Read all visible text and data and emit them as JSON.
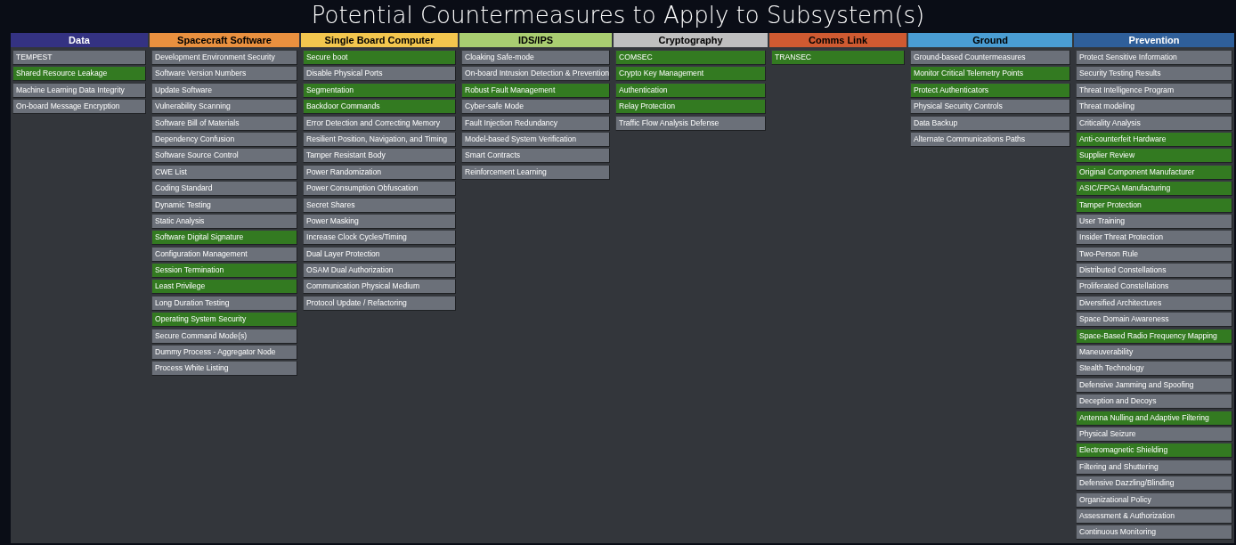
{
  "title": "Potential Countermeasures to Apply to Subsystem(s)",
  "columns": [
    {
      "name": "Data",
      "color": "#343282",
      "items": [
        {
          "label": "TEMPEST",
          "selected": false
        },
        {
          "label": "Shared Resource Leakage",
          "selected": true
        },
        {
          "label": "Machine Learning Data Integrity",
          "selected": false
        },
        {
          "label": "On-board Message Encryption",
          "selected": false
        }
      ]
    },
    {
      "name": "Spacecraft Software",
      "color": "#e9903f",
      "items": [
        {
          "label": "Development Environment Security",
          "selected": false
        },
        {
          "label": "Software Version Numbers",
          "selected": false
        },
        {
          "label": "Update Software",
          "selected": false
        },
        {
          "label": "Vulnerability Scanning",
          "selected": false
        },
        {
          "label": "Software Bill of Materials",
          "selected": false
        },
        {
          "label": "Dependency Confusion",
          "selected": false
        },
        {
          "label": "Software Source Control",
          "selected": false
        },
        {
          "label": "CWE List",
          "selected": false
        },
        {
          "label": "Coding Standard",
          "selected": false
        },
        {
          "label": "Dynamic Testing",
          "selected": false
        },
        {
          "label": "Static Analysis",
          "selected": false
        },
        {
          "label": "Software Digital Signature",
          "selected": true
        },
        {
          "label": "Configuration Management",
          "selected": false
        },
        {
          "label": "Session Termination",
          "selected": true
        },
        {
          "label": "Least Privilege",
          "selected": true
        },
        {
          "label": "Long Duration Testing",
          "selected": false
        },
        {
          "label": "Operating System Security",
          "selected": true
        },
        {
          "label": "Secure Command Mode(s)",
          "selected": false
        },
        {
          "label": "Dummy Process - Aggregator Node",
          "selected": false
        },
        {
          "label": "Process White Listing",
          "selected": false
        }
      ]
    },
    {
      "name": "Single Board Computer",
      "color": "#f3c64e",
      "items": [
        {
          "label": "Secure boot",
          "selected": true
        },
        {
          "label": "Disable Physical Ports",
          "selected": false
        },
        {
          "label": "Segmentation",
          "selected": true
        },
        {
          "label": "Backdoor Commands",
          "selected": true
        },
        {
          "label": "Error Detection and Correcting Memory",
          "selected": false
        },
        {
          "label": "Resilient Position, Navigation, and Timing",
          "selected": false
        },
        {
          "label": "Tamper Resistant Body",
          "selected": false
        },
        {
          "label": "Power Randomization",
          "selected": false
        },
        {
          "label": "Power Consumption Obfuscation",
          "selected": false
        },
        {
          "label": "Secret Shares",
          "selected": false
        },
        {
          "label": "Power Masking",
          "selected": false
        },
        {
          "label": "Increase Clock Cycles/Timing",
          "selected": false
        },
        {
          "label": "Dual Layer Protection",
          "selected": false
        },
        {
          "label": "OSAM Dual Authorization",
          "selected": false
        },
        {
          "label": "Communication Physical Medium",
          "selected": false
        },
        {
          "label": "Protocol Update / Refactoring",
          "selected": false
        }
      ]
    },
    {
      "name": "IDS/IPS",
      "color": "#a9cd71",
      "items": [
        {
          "label": "Cloaking Safe-mode",
          "selected": false
        },
        {
          "label": "On-board Intrusion Detection & Prevention",
          "selected": false
        },
        {
          "label": "Robust Fault Management",
          "selected": true
        },
        {
          "label": "Cyber-safe Mode",
          "selected": false
        },
        {
          "label": "Fault Injection Redundancy",
          "selected": false
        },
        {
          "label": "Model-based System Verification",
          "selected": false
        },
        {
          "label": "Smart Contracts",
          "selected": false
        },
        {
          "label": "Reinforcement Learning",
          "selected": false
        }
      ]
    },
    {
      "name": "Cryptography",
      "color": "#bfbfbf",
      "items": [
        {
          "label": "COMSEC",
          "selected": true
        },
        {
          "label": "Crypto Key Management",
          "selected": true
        },
        {
          "label": "Authentication",
          "selected": true
        },
        {
          "label": "Relay Protection",
          "selected": true
        },
        {
          "label": "Traffic Flow Analysis Defense",
          "selected": false
        }
      ]
    },
    {
      "name": "Comms Link",
      "color": "#cf5a31",
      "items": [
        {
          "label": "TRANSEC",
          "selected": true
        }
      ]
    },
    {
      "name": "Ground",
      "color": "#4a9dd3",
      "items": [
        {
          "label": "Ground-based Countermeasures",
          "selected": false
        },
        {
          "label": "Monitor Critical Telemetry Points",
          "selected": true
        },
        {
          "label": "Protect Authenticators",
          "selected": true
        },
        {
          "label": "Physical Security Controls",
          "selected": false
        },
        {
          "label": "Data Backup",
          "selected": false
        },
        {
          "label": "Alternate Communications Paths",
          "selected": false
        }
      ]
    },
    {
      "name": "Prevention",
      "color": "#2f5f9a",
      "items": [
        {
          "label": "Protect Sensitive Information",
          "selected": false
        },
        {
          "label": "Security Testing Results",
          "selected": false
        },
        {
          "label": "Threat Intelligence Program",
          "selected": false
        },
        {
          "label": "Threat modeling",
          "selected": false
        },
        {
          "label": "Criticality Analysis",
          "selected": false
        },
        {
          "label": "Anti-counterfeit Hardware",
          "selected": true
        },
        {
          "label": "Supplier Review",
          "selected": true
        },
        {
          "label": "Original Component Manufacturer",
          "selected": true
        },
        {
          "label": "ASIC/FPGA Manufacturing",
          "selected": true
        },
        {
          "label": "Tamper Protection",
          "selected": true
        },
        {
          "label": "User Training",
          "selected": false
        },
        {
          "label": "Insider Threat Protection",
          "selected": false
        },
        {
          "label": "Two-Person Rule",
          "selected": false
        },
        {
          "label": "Distributed Constellations",
          "selected": false
        },
        {
          "label": "Proliferated Constellations",
          "selected": false
        },
        {
          "label": "Diversified Architectures",
          "selected": false
        },
        {
          "label": "Space Domain Awareness",
          "selected": false
        },
        {
          "label": "Space-Based Radio Frequency Mapping",
          "selected": true
        },
        {
          "label": "Maneuverability",
          "selected": false
        },
        {
          "label": "Stealth Technology",
          "selected": false
        },
        {
          "label": "Defensive Jamming and Spoofing",
          "selected": false
        },
        {
          "label": "Deception and Decoys",
          "selected": false
        },
        {
          "label": "Antenna Nulling and Adaptive Filtering",
          "selected": true
        },
        {
          "label": "Physical Seizure",
          "selected": false
        },
        {
          "label": "Electromagnetic Shielding",
          "selected": true
        },
        {
          "label": "Filtering and Shuttering",
          "selected": false
        },
        {
          "label": "Defensive Dazzling/Blinding",
          "selected": false
        },
        {
          "label": "Organizational Policy",
          "selected": false
        },
        {
          "label": "Assessment & Authorization",
          "selected": false
        },
        {
          "label": "Continuous Monitoring",
          "selected": false
        }
      ]
    }
  ]
}
